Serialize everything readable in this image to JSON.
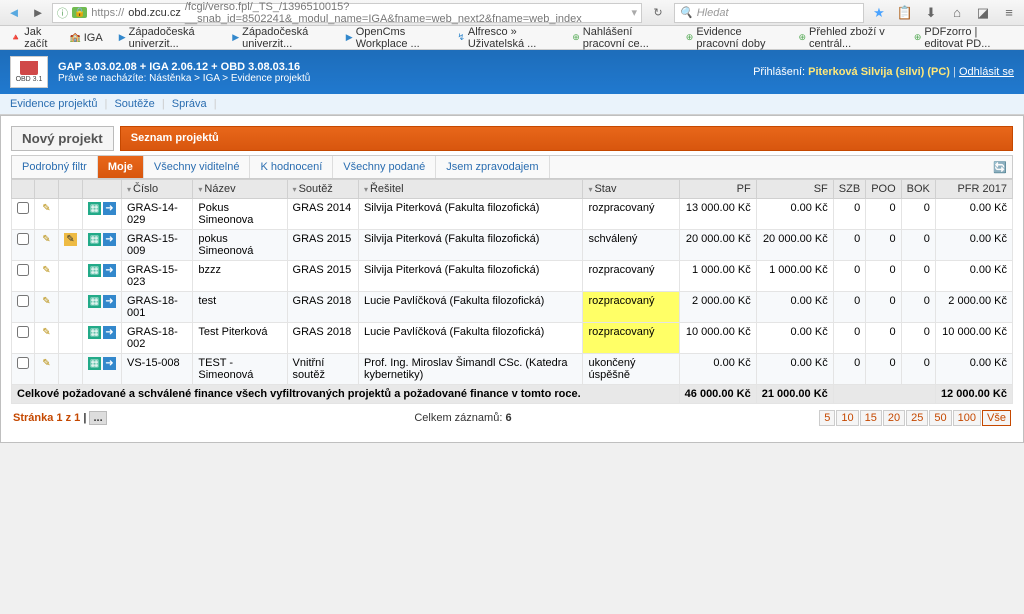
{
  "browser": {
    "url_prefix": "https://",
    "url_host": "obd.zcu.cz",
    "url_rest": "/fcgi/verso.fpl/_TS_/1396510015?__snab_id=8502241&_modul_name=IGA&fname=web_next2&fname=web_index",
    "search_placeholder": "Hledat"
  },
  "bookmarks": [
    "Jak začít",
    "IGA",
    "Západočeská univerzit...",
    "Západočeská univerzit...",
    "OpenCms Workplace ...",
    "Alfresco » Uživatelská ...",
    "Nahlášení pracovní ce...",
    "Evidence pracovní doby",
    "Přehled zboží v centrál...",
    "PDFzorro | editovat PD..."
  ],
  "app": {
    "version_line": "GAP 3.03.02.08 + IGA 2.06.12 + OBD 3.08.03.16",
    "breadcrumb": "Právě se nacházíte: Nástěnka  >  IGA  >  Evidence projektů",
    "logo_label": "OBD 3.1",
    "login_label": "Přihlášení:",
    "user": "Piterková Silvija (silvi) (PC)",
    "logout": "Odhlásit se"
  },
  "nav": {
    "items": [
      "Evidence projektů",
      "Soutěže",
      "Správa"
    ]
  },
  "page": {
    "new_button": "Nový projekt",
    "title": "Seznam projektů",
    "tabs": [
      "Podrobný filtr",
      "Moje",
      "Všechny viditelné",
      "K hodnocení",
      "Všechny podané",
      "Jsem zpravodajem"
    ],
    "active_tab": 1
  },
  "columns": [
    "",
    "",
    "",
    "",
    "Číslo",
    "Název",
    "Soutěž",
    "Řešitel",
    "Stav",
    "PF",
    "SF",
    "SZB",
    "POO",
    "BOK",
    "PFR 2017"
  ],
  "rows": [
    {
      "cislo": "GRAS-14-029",
      "nazev": "Pokus Simeonova",
      "soutez": "GRAS 2014",
      "resitel": "Silvija Piterková (Fakulta filozofická)",
      "stav": "rozpracovaný",
      "pf": "13 000.00  Kč",
      "sf": "0.00  Kč",
      "szb": "0",
      "poo": "0",
      "bok": "0",
      "pfr": "0.00  Kč",
      "hl": false,
      "extra": false
    },
    {
      "cislo": "GRAS-15-009",
      "nazev": "pokus Simeonová",
      "soutez": "GRAS 2015",
      "resitel": "Silvija Piterková (Fakulta filozofická)",
      "stav": "schválený",
      "pf": "20 000.00  Kč",
      "sf": "20 000.00  Kč",
      "szb": "0",
      "poo": "0",
      "bok": "0",
      "pfr": "0.00  Kč",
      "hl": false,
      "extra": true
    },
    {
      "cislo": "GRAS-15-023",
      "nazev": "bzzz",
      "soutez": "GRAS 2015",
      "resitel": "Silvija Piterková (Fakulta filozofická)",
      "stav": "rozpracovaný",
      "pf": "1 000.00  Kč",
      "sf": "1 000.00  Kč",
      "szb": "0",
      "poo": "0",
      "bok": "0",
      "pfr": "0.00  Kč",
      "hl": false,
      "extra": false
    },
    {
      "cislo": "GRAS-18-001",
      "nazev": "test",
      "soutez": "GRAS 2018",
      "resitel": "Lucie Pavlíčková (Fakulta filozofická)",
      "stav": "rozpracovaný",
      "pf": "2 000.00  Kč",
      "sf": "0.00  Kč",
      "szb": "0",
      "poo": "0",
      "bok": "0",
      "pfr": "2 000.00  Kč",
      "hl": true,
      "extra": false
    },
    {
      "cislo": "GRAS-18-002",
      "nazev": "Test Piterková",
      "soutez": "GRAS 2018",
      "resitel": "Lucie Pavlíčková (Fakulta filozofická)",
      "stav": "rozpracovaný",
      "pf": "10 000.00  Kč",
      "sf": "0.00  Kč",
      "szb": "0",
      "poo": "0",
      "bok": "0",
      "pfr": "10 000.00  Kč",
      "hl": true,
      "extra": false
    },
    {
      "cislo": "VS-15-008",
      "nazev": "TEST - Simeonová",
      "soutez": "Vnitřní soutěž",
      "resitel": "Prof. Ing. Miroslav Šimandl CSc. (Katedra kybernetiky)",
      "stav": "ukončený úspěšně",
      "pf": "0.00  Kč",
      "sf": "0.00  Kč",
      "szb": "0",
      "poo": "0",
      "bok": "0",
      "pfr": "0.00  Kč",
      "hl": false,
      "extra": false
    }
  ],
  "totals": {
    "label": "Celkové požadované a schválené finance všech vyfiltrovaných projektů a požadované finance v tomto roce.",
    "pf": "46 000.00 Kč",
    "sf": "21 000.00 Kč",
    "pfr": "12 000.00 Kč"
  },
  "pager": {
    "page_text": "Stránka 1 z 1",
    "count_label": "Celkem záznamů:",
    "count": "6",
    "sizes": [
      "5",
      "10",
      "15",
      "20",
      "25",
      "50",
      "100",
      "Vše"
    ]
  }
}
